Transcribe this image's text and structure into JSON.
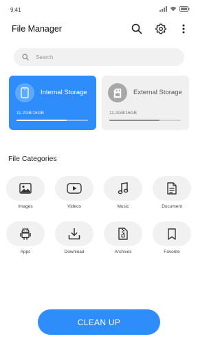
{
  "status_bar": {
    "time": "9:41"
  },
  "header": {
    "title": "File Manager"
  },
  "search": {
    "placeholder": "Search"
  },
  "storage": {
    "internal": {
      "label": "Internal Storage",
      "usage": "11.2GB/16GB",
      "used_fraction": 0.7
    },
    "external": {
      "label": "External Storage",
      "usage": "11.2GB/16GB",
      "used_fraction": 0.7
    }
  },
  "categories": {
    "title": "File Categories",
    "items": [
      {
        "label": "Images",
        "icon": "image-icon"
      },
      {
        "label": "Videos",
        "icon": "play-video-icon"
      },
      {
        "label": "Music",
        "icon": "music-note-icon"
      },
      {
        "label": "Document",
        "icon": "document-icon"
      },
      {
        "label": "Apps",
        "icon": "android-icon"
      },
      {
        "label": "Download",
        "icon": "download-icon"
      },
      {
        "label": "Archives",
        "icon": "archive-zip-icon"
      },
      {
        "label": "Favorite",
        "icon": "bookmark-icon"
      }
    ]
  },
  "actions": {
    "cleanup_label": "CLEAN UP"
  },
  "colors": {
    "accent": "#2f8dfb",
    "pill_bg": "#f1f1f1",
    "external_card_bg": "#f0f0f0"
  }
}
